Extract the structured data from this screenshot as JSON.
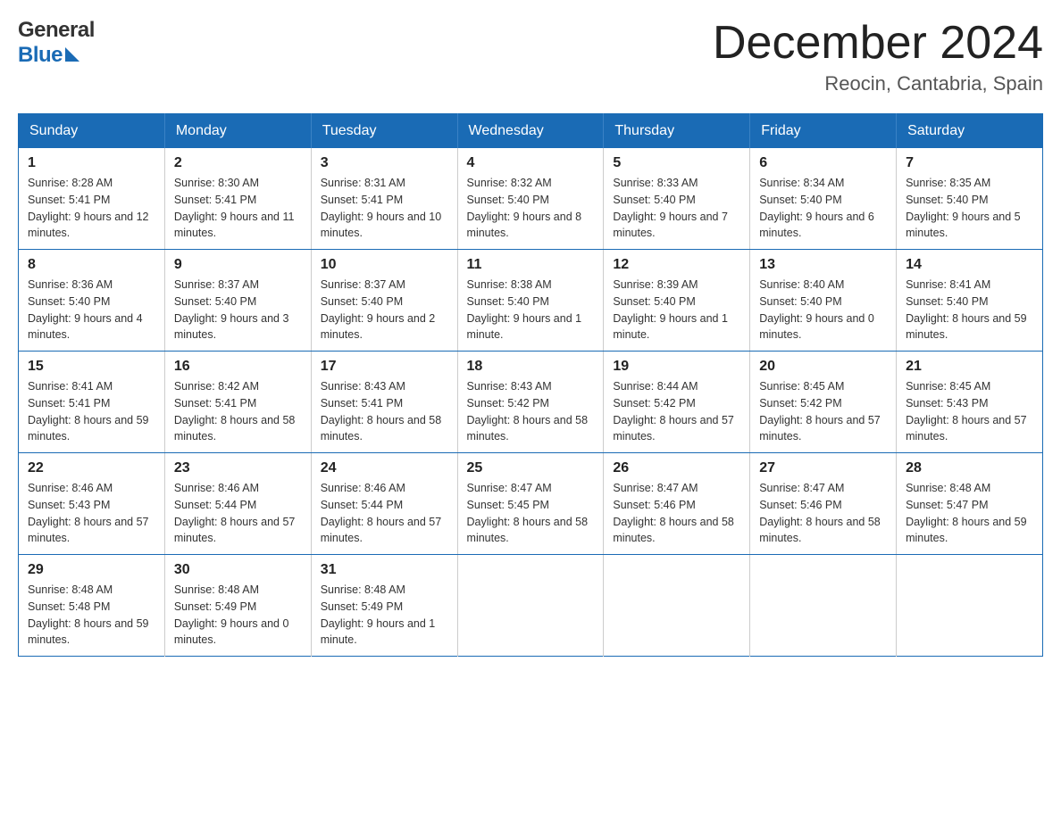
{
  "header": {
    "month_year": "December 2024",
    "location": "Reocin, Cantabria, Spain",
    "logo_general": "General",
    "logo_blue": "Blue"
  },
  "days_of_week": [
    "Sunday",
    "Monday",
    "Tuesday",
    "Wednesday",
    "Thursday",
    "Friday",
    "Saturday"
  ],
  "weeks": [
    [
      {
        "day": "1",
        "sunrise": "Sunrise: 8:28 AM",
        "sunset": "Sunset: 5:41 PM",
        "daylight": "Daylight: 9 hours and 12 minutes."
      },
      {
        "day": "2",
        "sunrise": "Sunrise: 8:30 AM",
        "sunset": "Sunset: 5:41 PM",
        "daylight": "Daylight: 9 hours and 11 minutes."
      },
      {
        "day": "3",
        "sunrise": "Sunrise: 8:31 AM",
        "sunset": "Sunset: 5:41 PM",
        "daylight": "Daylight: 9 hours and 10 minutes."
      },
      {
        "day": "4",
        "sunrise": "Sunrise: 8:32 AM",
        "sunset": "Sunset: 5:40 PM",
        "daylight": "Daylight: 9 hours and 8 minutes."
      },
      {
        "day": "5",
        "sunrise": "Sunrise: 8:33 AM",
        "sunset": "Sunset: 5:40 PM",
        "daylight": "Daylight: 9 hours and 7 minutes."
      },
      {
        "day": "6",
        "sunrise": "Sunrise: 8:34 AM",
        "sunset": "Sunset: 5:40 PM",
        "daylight": "Daylight: 9 hours and 6 minutes."
      },
      {
        "day": "7",
        "sunrise": "Sunrise: 8:35 AM",
        "sunset": "Sunset: 5:40 PM",
        "daylight": "Daylight: 9 hours and 5 minutes."
      }
    ],
    [
      {
        "day": "8",
        "sunrise": "Sunrise: 8:36 AM",
        "sunset": "Sunset: 5:40 PM",
        "daylight": "Daylight: 9 hours and 4 minutes."
      },
      {
        "day": "9",
        "sunrise": "Sunrise: 8:37 AM",
        "sunset": "Sunset: 5:40 PM",
        "daylight": "Daylight: 9 hours and 3 minutes."
      },
      {
        "day": "10",
        "sunrise": "Sunrise: 8:37 AM",
        "sunset": "Sunset: 5:40 PM",
        "daylight": "Daylight: 9 hours and 2 minutes."
      },
      {
        "day": "11",
        "sunrise": "Sunrise: 8:38 AM",
        "sunset": "Sunset: 5:40 PM",
        "daylight": "Daylight: 9 hours and 1 minute."
      },
      {
        "day": "12",
        "sunrise": "Sunrise: 8:39 AM",
        "sunset": "Sunset: 5:40 PM",
        "daylight": "Daylight: 9 hours and 1 minute."
      },
      {
        "day": "13",
        "sunrise": "Sunrise: 8:40 AM",
        "sunset": "Sunset: 5:40 PM",
        "daylight": "Daylight: 9 hours and 0 minutes."
      },
      {
        "day": "14",
        "sunrise": "Sunrise: 8:41 AM",
        "sunset": "Sunset: 5:40 PM",
        "daylight": "Daylight: 8 hours and 59 minutes."
      }
    ],
    [
      {
        "day": "15",
        "sunrise": "Sunrise: 8:41 AM",
        "sunset": "Sunset: 5:41 PM",
        "daylight": "Daylight: 8 hours and 59 minutes."
      },
      {
        "day": "16",
        "sunrise": "Sunrise: 8:42 AM",
        "sunset": "Sunset: 5:41 PM",
        "daylight": "Daylight: 8 hours and 58 minutes."
      },
      {
        "day": "17",
        "sunrise": "Sunrise: 8:43 AM",
        "sunset": "Sunset: 5:41 PM",
        "daylight": "Daylight: 8 hours and 58 minutes."
      },
      {
        "day": "18",
        "sunrise": "Sunrise: 8:43 AM",
        "sunset": "Sunset: 5:42 PM",
        "daylight": "Daylight: 8 hours and 58 minutes."
      },
      {
        "day": "19",
        "sunrise": "Sunrise: 8:44 AM",
        "sunset": "Sunset: 5:42 PM",
        "daylight": "Daylight: 8 hours and 57 minutes."
      },
      {
        "day": "20",
        "sunrise": "Sunrise: 8:45 AM",
        "sunset": "Sunset: 5:42 PM",
        "daylight": "Daylight: 8 hours and 57 minutes."
      },
      {
        "day": "21",
        "sunrise": "Sunrise: 8:45 AM",
        "sunset": "Sunset: 5:43 PM",
        "daylight": "Daylight: 8 hours and 57 minutes."
      }
    ],
    [
      {
        "day": "22",
        "sunrise": "Sunrise: 8:46 AM",
        "sunset": "Sunset: 5:43 PM",
        "daylight": "Daylight: 8 hours and 57 minutes."
      },
      {
        "day": "23",
        "sunrise": "Sunrise: 8:46 AM",
        "sunset": "Sunset: 5:44 PM",
        "daylight": "Daylight: 8 hours and 57 minutes."
      },
      {
        "day": "24",
        "sunrise": "Sunrise: 8:46 AM",
        "sunset": "Sunset: 5:44 PM",
        "daylight": "Daylight: 8 hours and 57 minutes."
      },
      {
        "day": "25",
        "sunrise": "Sunrise: 8:47 AM",
        "sunset": "Sunset: 5:45 PM",
        "daylight": "Daylight: 8 hours and 58 minutes."
      },
      {
        "day": "26",
        "sunrise": "Sunrise: 8:47 AM",
        "sunset": "Sunset: 5:46 PM",
        "daylight": "Daylight: 8 hours and 58 minutes."
      },
      {
        "day": "27",
        "sunrise": "Sunrise: 8:47 AM",
        "sunset": "Sunset: 5:46 PM",
        "daylight": "Daylight: 8 hours and 58 minutes."
      },
      {
        "day": "28",
        "sunrise": "Sunrise: 8:48 AM",
        "sunset": "Sunset: 5:47 PM",
        "daylight": "Daylight: 8 hours and 59 minutes."
      }
    ],
    [
      {
        "day": "29",
        "sunrise": "Sunrise: 8:48 AM",
        "sunset": "Sunset: 5:48 PM",
        "daylight": "Daylight: 8 hours and 59 minutes."
      },
      {
        "day": "30",
        "sunrise": "Sunrise: 8:48 AM",
        "sunset": "Sunset: 5:49 PM",
        "daylight": "Daylight: 9 hours and 0 minutes."
      },
      {
        "day": "31",
        "sunrise": "Sunrise: 8:48 AM",
        "sunset": "Sunset: 5:49 PM",
        "daylight": "Daylight: 9 hours and 1 minute."
      },
      null,
      null,
      null,
      null
    ]
  ]
}
